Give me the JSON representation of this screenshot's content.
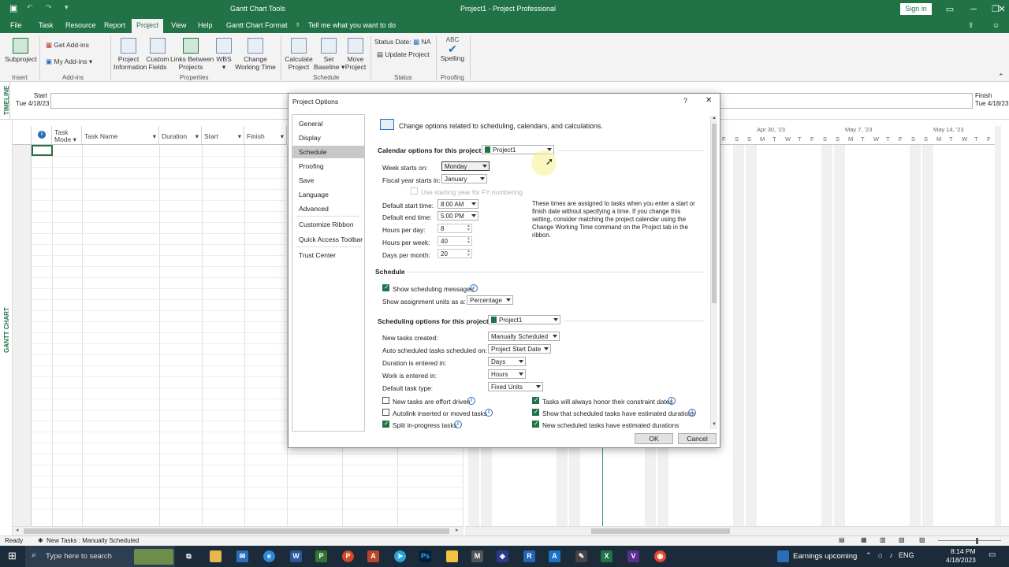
{
  "window": {
    "title": "Project1  -  Project Professional",
    "tools_title": "Gantt Chart Tools",
    "sign_in": "Sign in",
    "tell_me": "Tell me what you want to do"
  },
  "tabs": [
    "File",
    "Task",
    "Resource",
    "Report",
    "Project",
    "View",
    "Help",
    "Gantt Chart Format"
  ],
  "active_tab": "Project",
  "ribbon": {
    "subproject": "Subproject",
    "get_addins": "Get Add-ins",
    "my_addins": "My Add-ins",
    "project_information": [
      "Project",
      "Information"
    ],
    "custom_fields": [
      "Custom",
      "Fields"
    ],
    "links_between_projects": [
      "Links Between",
      "Projects"
    ],
    "wbs": "WBS",
    "change_working_time": [
      "Change",
      "Working Time"
    ],
    "calculate_project": [
      "Calculate",
      "Project"
    ],
    "set_baseline": [
      "Set",
      "Baseline"
    ],
    "move_project": [
      "Move",
      "Project"
    ],
    "status_date": "Status Date:",
    "status_date_value": "NA",
    "update_project": "Update Project",
    "spelling": "Spelling",
    "abc": "ABC",
    "groups": [
      "Insert",
      "Add-ins",
      "Properties",
      "Schedule",
      "Status",
      "Proofing"
    ]
  },
  "timeline": {
    "label": "TIMELINE",
    "start_label": "Start",
    "start_date": "Tue 4/18/23",
    "finish_label": "Finish",
    "finish_date": "Tue 4/18/23"
  },
  "grid": {
    "side_label": "GANTT CHART",
    "columns": [
      "Task Mode",
      "Task Name",
      "Duration",
      "Start",
      "Finish"
    ]
  },
  "gantt": {
    "weeks": [
      "Apr 30, '23",
      "May 7, '23",
      "May 14, '23"
    ],
    "days": [
      "F",
      "S",
      "S",
      "M",
      "T",
      "W",
      "T",
      "F",
      "S",
      "S",
      "M",
      "T",
      "W",
      "T",
      "F",
      "S",
      "S",
      "M",
      "T",
      "W",
      "T",
      "F",
      "S",
      "S",
      "M",
      "T",
      "W",
      "T",
      "F",
      "S"
    ]
  },
  "dialog": {
    "title": "Project Options",
    "help": "?",
    "close": "✕",
    "nav": [
      "General",
      "Display",
      "Schedule",
      "Proofing",
      "Save",
      "Language",
      "Advanced",
      "Customize Ribbon",
      "Quick Access Toolbar",
      "Trust Center"
    ],
    "selected_nav": "Schedule",
    "header": "Change options related to scheduling, calendars, and calculations.",
    "calendar_section": "Calendar options for this project:",
    "calendar_project": "Project1",
    "week_starts_label": "Week starts on:",
    "week_starts_value": "Monday",
    "fiscal_year_label": "Fiscal year starts in:",
    "fiscal_year_value": "January",
    "use_starting_year": "Use starting year for FY numbering",
    "default_start_label": "Default start time:",
    "default_start_value": "8:00 AM",
    "default_end_label": "Default end time:",
    "default_end_value": "5:00 PM",
    "hours_per_day_label": "Hours per day:",
    "hours_per_day_value": "8",
    "hours_per_week_label": "Hours per week:",
    "hours_per_week_value": "40",
    "days_per_month_label": "Days per month:",
    "days_per_month_value": "20",
    "times_note": "These times are assigned to tasks when you enter a start or finish date without specifying a time. If you change this setting, consider matching the project calendar using the Change Working Time command on the Project tab in the ribbon.",
    "schedule_section": "Schedule",
    "show_scheduling_messages": "Show scheduling messages",
    "show_assignment_units_label": "Show assignment units as a:",
    "show_assignment_units_value": "Percentage",
    "scheduling_section": "Scheduling options for this project:",
    "scheduling_project": "Project1",
    "new_tasks_created_label": "New tasks created:",
    "new_tasks_created_value": "Manually Scheduled",
    "auto_scheduled_label": "Auto scheduled tasks scheduled on:",
    "auto_scheduled_value": "Project Start Date",
    "duration_entered_label": "Duration is entered in:",
    "duration_entered_value": "Days",
    "work_entered_label": "Work is entered in:",
    "work_entered_value": "Hours",
    "default_task_type_label": "Default task type:",
    "default_task_type_value": "Fixed Units",
    "checks_left": [
      {
        "label": "New tasks are effort driven",
        "checked": false
      },
      {
        "label": "Autolink inserted or moved tasks",
        "checked": false
      },
      {
        "label": "Split in-progress tasks",
        "checked": true
      }
    ],
    "checks_right": [
      {
        "label": "Tasks will always honor their constraint dates",
        "checked": true
      },
      {
        "label": "Show that scheduled tasks have estimated durations",
        "checked": true
      },
      {
        "label": "New scheduled tasks have estimated durations",
        "checked": true
      }
    ],
    "ok": "OK",
    "cancel": "Cancel"
  },
  "statusbar": {
    "ready": "Ready",
    "new_tasks": "New Tasks : Manually Scheduled"
  },
  "taskbar": {
    "search_placeholder": "Type here to search",
    "earnings": "Earnings upcoming",
    "lang": "ENG",
    "time": "8:14 PM",
    "date": "4/18/2023"
  },
  "colors": {
    "accent": "#217346",
    "taskbar": "#1c2b3a"
  }
}
